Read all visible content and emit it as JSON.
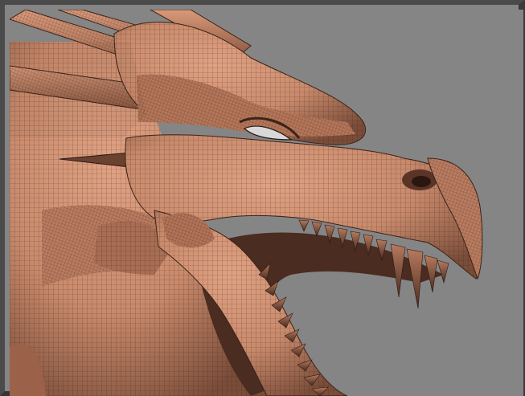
{
  "viewport": {
    "subject": "dragon-head-wireframe-sculpt",
    "background_color": "#858585",
    "frame_color": "#4a4a4a",
    "skin_color": "#c98a6c",
    "skin_shadow_color": "#7a4d39",
    "wire_color": "#2b1a13"
  }
}
